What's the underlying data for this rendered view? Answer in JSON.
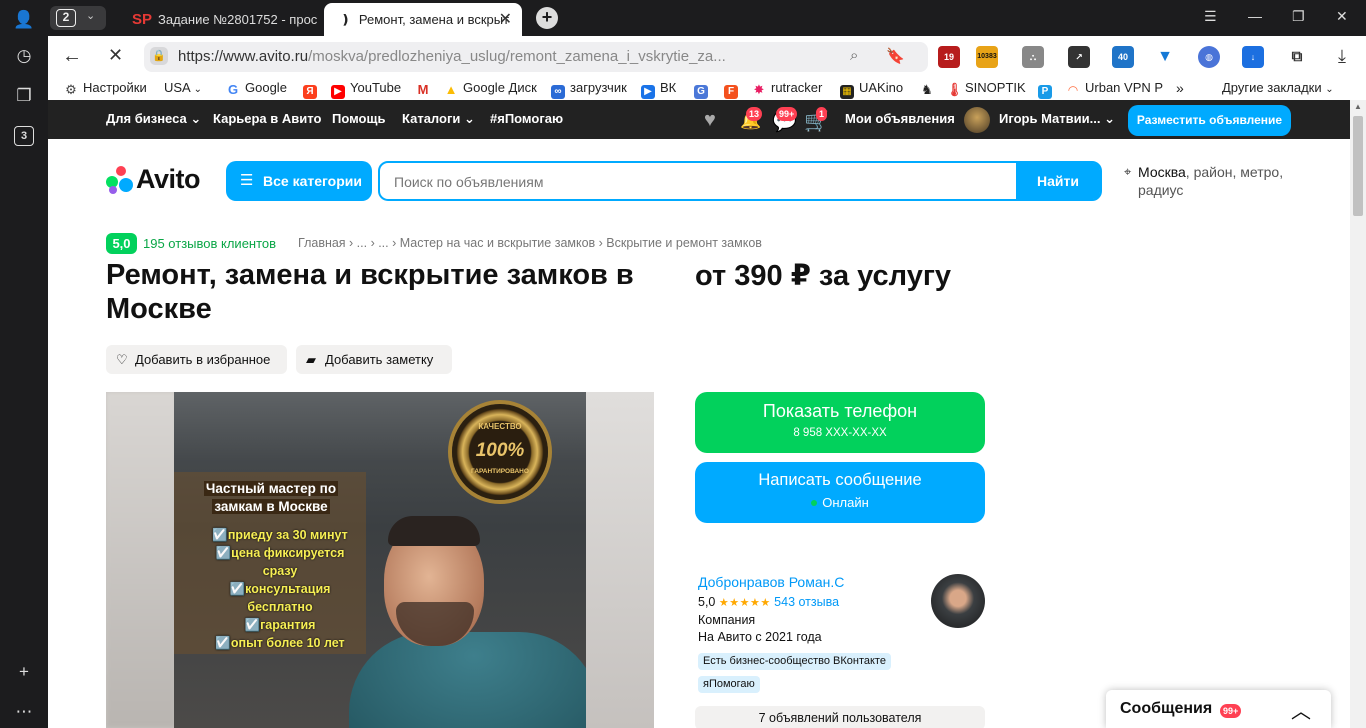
{
  "browser": {
    "rail": {
      "tab_count_badge": "3"
    },
    "tabstrip": {
      "tab_counter": "2",
      "tabs": [
        {
          "favicon": "SP",
          "title": "Задание №2801752 - прос"
        },
        {
          "favicon": "❫",
          "title": "Ремонт, замена и вскрыт"
        }
      ]
    },
    "address": {
      "domain": "https://www.avito.ru",
      "path": "/moskva/predlozheniya_uslug/remont_zamena_i_vskrytie_za..."
    },
    "extensions": {
      "ext1_badge": "19",
      "ext2_badge": "10383",
      "ext3_badge": "40"
    },
    "bookmarks": [
      {
        "label": "Настройки",
        "icon": "gear-icon"
      },
      {
        "label": "USA",
        "icon": "dropdown"
      },
      {
        "label": "Google",
        "icon": "google-icon"
      },
      {
        "label": "",
        "icon": "yandex-icon"
      },
      {
        "label": "YouTube",
        "icon": "youtube-icon"
      },
      {
        "label": "",
        "icon": "gmail-icon"
      },
      {
        "label": "Google Диск",
        "icon": "drive-icon"
      },
      {
        "label": "загрузчик",
        "icon": "loader-icon"
      },
      {
        "label": "ВК",
        "icon": "vk-icon"
      },
      {
        "label": "",
        "icon": "translate-icon"
      },
      {
        "label": "",
        "icon": "f-icon"
      },
      {
        "label": "rutracker",
        "icon": "rutracker-icon"
      },
      {
        "label": "UAKino",
        "icon": "uakino-icon"
      },
      {
        "label": "",
        "icon": "chess-icon"
      },
      {
        "label": "SINOPTIK",
        "icon": "thermometer-icon"
      },
      {
        "label": "",
        "icon": "p-icon"
      },
      {
        "label": "Urban VPN P",
        "icon": "rainbow-icon"
      },
      {
        "label": "»",
        "icon": "more"
      },
      {
        "label": "Другие закладки",
        "icon": "folder"
      }
    ]
  },
  "avito": {
    "topnav": {
      "business": "Для бизнеса",
      "career": "Карьера в Авито",
      "help": "Помощь",
      "catalogs": "Каталоги",
      "ihelp": "#яПомогаю",
      "notif_badge": "13",
      "msg_badge": "99+",
      "cart_badge": "1",
      "my_ads": "Мои объявления",
      "user": "Игорь Матвии...",
      "post_ad": "Разместить объявление"
    },
    "header": {
      "logo": "Avito",
      "all_categories": "Все категории",
      "search_placeholder": "Поиск по объявлениям",
      "search_button": "Найти",
      "location_city": "Москва",
      "location_rest": ", район, метро, радиус"
    },
    "listing": {
      "rating_score": "5,0",
      "rating_reviews": "195 отзывов клиентов",
      "breadcrumbs": "Главная › ... › ... › Мастер на час и вскрытие замков › Вскрытие и ремонт замков",
      "title": "Ремонт, замена и вскрытие замков в Москве",
      "price": "от 390 ₽ за услугу",
      "add_favorite": "Добавить в избранное",
      "add_note": "Добавить заметку",
      "photo": {
        "seal_top": "КАЧЕСТВО",
        "seal_mid": "100%",
        "seal_bottom": "ГАРАНТИРОВАНО",
        "panel_title_1": "Частный мастер по",
        "panel_title_2": "замкам в Москве",
        "features": [
          "☑️приеду за 30 минут",
          "☑️цена фиксируется",
          "сразу",
          "☑️консультация",
          "бесплатно",
          "☑️гарантия",
          "☑️опыт более 10 лет"
        ]
      }
    },
    "contact": {
      "show_phone": "Показать телефон",
      "phone_masked": "8 958 XXX-XX-XX",
      "write_message": "Написать сообщение",
      "online": "Онлайн"
    },
    "seller": {
      "name": "Добронравов Роман.С",
      "score": "5,0",
      "stars": "★★★★★",
      "reviews": "543 отзыва",
      "type": "Компания",
      "since": "На Авито с 2021 года",
      "tag1": "Есть бизнес-сообщество ВКонтакте",
      "tag2": "яПомогаю",
      "ads_count": "7 объявлений пользователя"
    },
    "messages_widget": {
      "label": "Сообщения",
      "badge": "99+"
    }
  }
}
